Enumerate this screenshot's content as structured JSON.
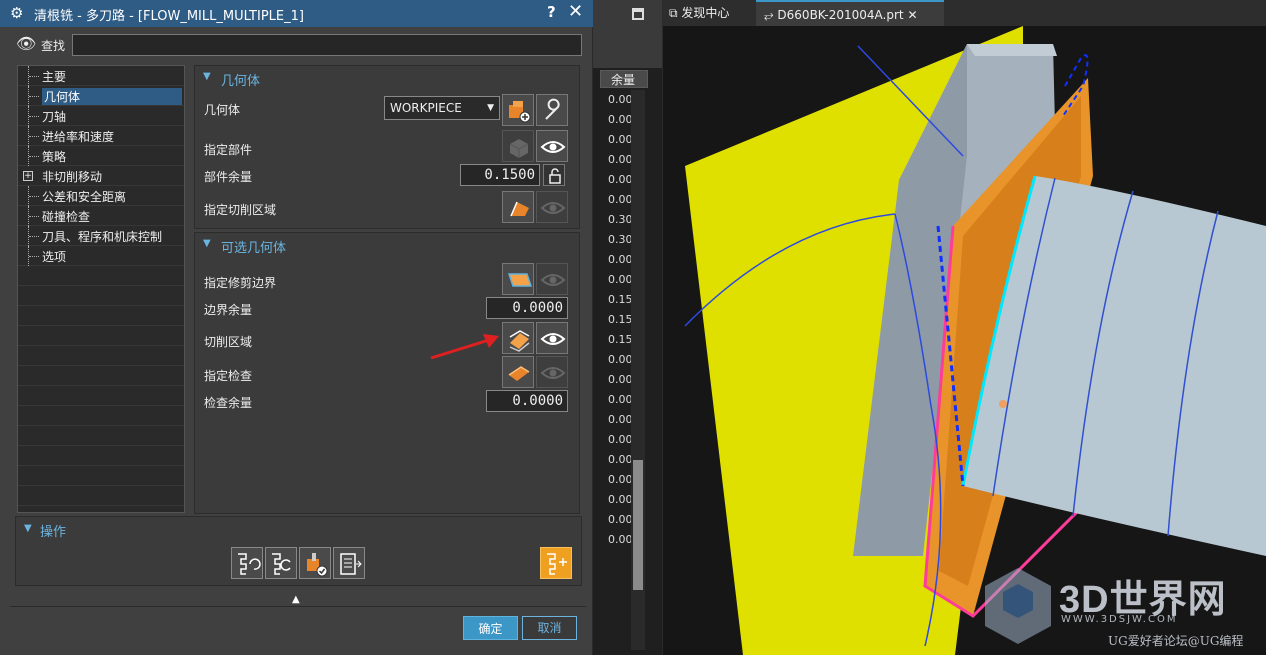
{
  "dialog": {
    "title": "清根铣 - 多刀路 - [FLOW_MILL_MULTIPLE_1]",
    "help_label": "?",
    "close_label": "✕",
    "find_label": "查找",
    "find_value": ""
  },
  "tree": {
    "items": [
      {
        "label": "主要"
      },
      {
        "label": "几何体",
        "selected": true
      },
      {
        "label": "刀轴"
      },
      {
        "label": "进给率和速度"
      },
      {
        "label": "策略"
      },
      {
        "label": "非切削移动",
        "expandable": true
      },
      {
        "label": "公差和安全距离"
      },
      {
        "label": "碰撞检查"
      },
      {
        "label": "刀具、程序和机床控制"
      },
      {
        "label": "选项"
      }
    ]
  },
  "geometry": {
    "header": "几何体",
    "geometry_label": "几何体",
    "geometry_value": "WORKPIECE",
    "specify_part_label": "指定部件",
    "part_stock_label": "部件余量",
    "part_stock_value": "0.1500",
    "specify_cut_area_label": "指定切削区域"
  },
  "optional_geometry": {
    "header": "可选几何体",
    "trim_boundary_label": "指定修剪边界",
    "boundary_stock_label": "边界余量",
    "boundary_stock_value": "0.0000",
    "cut_region_label": "切削区域",
    "check_label": "指定检查",
    "check_stock_label": "检查余量",
    "check_stock_value": "0.0000"
  },
  "operations": {
    "header": "操作"
  },
  "buttons": {
    "ok": "确定",
    "cancel": "取消"
  },
  "background_table": {
    "header": "余量",
    "values": [
      "0.00",
      "0.00",
      "0.00",
      "0.00",
      "0.00",
      "0.00",
      "0.30",
      "0.30",
      "0.00",
      "0.00",
      "0.15",
      "0.15",
      "0.15",
      "0.00",
      "0.00",
      "0.00",
      "0.00",
      "0.00",
      "0.00",
      "0.00",
      "0.00",
      "0.00",
      "0.00"
    ]
  },
  "viewport": {
    "tabs": [
      {
        "label": "发现中心"
      },
      {
        "label": "D660BK-201004A.prt"
      }
    ],
    "watermark": {
      "brand": "3D世界网",
      "url": "WWW.3DSJW.COM",
      "forum": "UG爱好者论坛@UG编程"
    }
  },
  "colors": {
    "accent": "#3c97c6",
    "title_bar": "#2f5c85",
    "header_text": "#6bb4e0",
    "yellow_plane": "#e0e000",
    "orange_part": "#e8a23a",
    "annotation_arrow": "#e02020"
  }
}
